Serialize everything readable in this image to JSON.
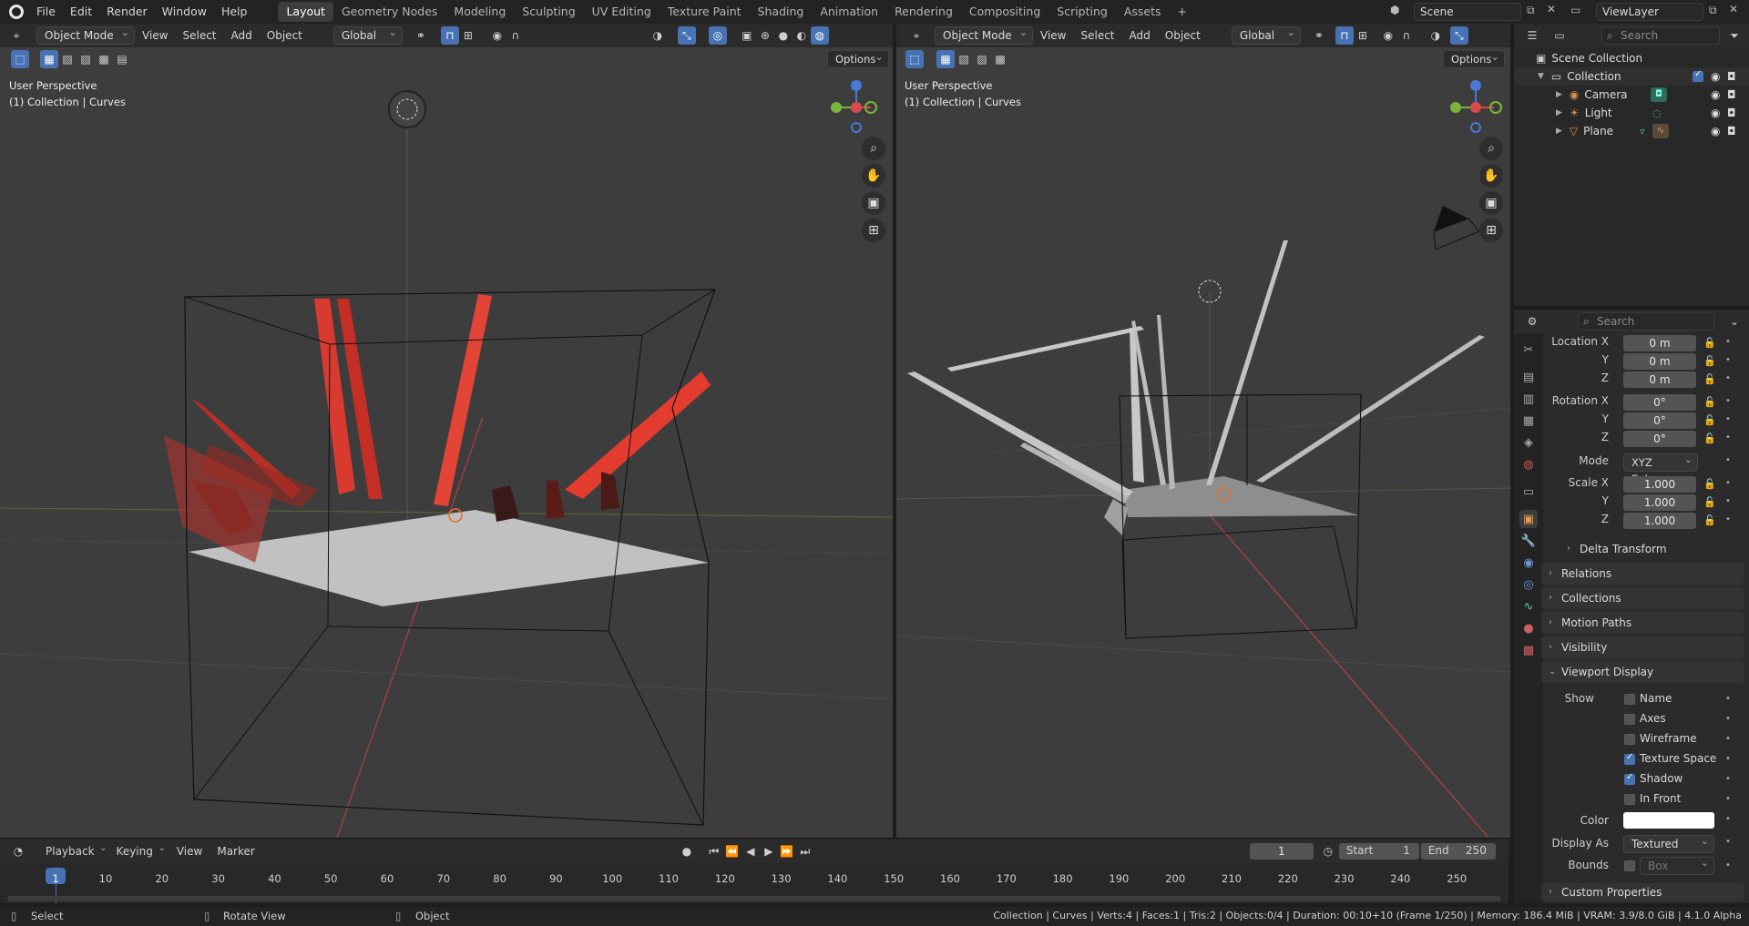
{
  "topbar": {
    "menus": [
      "File",
      "Edit",
      "Render",
      "Window",
      "Help"
    ],
    "workspaces": [
      "Layout",
      "Geometry Nodes",
      "Modeling",
      "Sculpting",
      "UV Editing",
      "Texture Paint",
      "Shading",
      "Animation",
      "Rendering",
      "Compositing",
      "Scripting",
      "Assets"
    ],
    "active_workspace": "Layout",
    "add_workspace": "+",
    "scene": "Scene",
    "view_layer": "ViewLayer"
  },
  "viewport_left": {
    "mode": "Object Mode",
    "menus": [
      "View",
      "Select",
      "Add",
      "Object"
    ],
    "orientation": "Global",
    "options": "Options",
    "perspective": "User Perspective",
    "collection_info": "(1) Collection | Curves"
  },
  "viewport_right": {
    "mode": "Object Mode",
    "menus": [
      "View",
      "Select",
      "Add",
      "Object"
    ],
    "orientation": "Global",
    "options": "Options",
    "perspective": "User Perspective",
    "collection_info": "(1) Collection | Curves"
  },
  "outliner": {
    "search_placeholder": "Search",
    "scene_collection": "Scene Collection",
    "collection": "Collection",
    "items": [
      {
        "name": "Camera",
        "icon": "camera-icon"
      },
      {
        "name": "Light",
        "icon": "light-icon"
      },
      {
        "name": "Plane",
        "icon": "mesh-icon"
      }
    ]
  },
  "properties": {
    "search_placeholder": "Search",
    "location": {
      "label": "Location X",
      "x": "0 m",
      "y": "0 m",
      "z": "0 m"
    },
    "rotation": {
      "label": "Rotation X",
      "x": "0°",
      "y": "0°",
      "z": "0°"
    },
    "axis_y": "Y",
    "axis_z": "Z",
    "mode_label": "Mode",
    "mode_value": "XYZ Euler",
    "scale": {
      "label": "Scale X",
      "x": "1.000",
      "y": "1.000",
      "z": "1.000"
    },
    "delta_transform": "Delta Transform",
    "panels": [
      "Relations",
      "Collections",
      "Motion Paths",
      "Visibility"
    ],
    "viewport_display": "Viewport Display",
    "show_label": "Show",
    "show_options": [
      {
        "label": "Name",
        "checked": false
      },
      {
        "label": "Axes",
        "checked": false
      },
      {
        "label": "Wireframe",
        "checked": false
      },
      {
        "label": "Texture Space",
        "checked": true
      },
      {
        "label": "Shadow",
        "checked": true
      },
      {
        "label": "In Front",
        "checked": false
      }
    ],
    "color_label": "Color",
    "color_value": "#ffffff",
    "display_as_label": "Display As",
    "display_as_value": "Textured",
    "bounds_label": "Bounds",
    "bounds_value": "Box",
    "custom_properties": "Custom Properties"
  },
  "timeline": {
    "menus": [
      "Playback",
      "Keying",
      "View",
      "Marker"
    ],
    "current_frame": "1",
    "start_label": "Start",
    "start": "1",
    "end_label": "End",
    "end": "250",
    "ticks": [
      "1",
      "10",
      "20",
      "30",
      "40",
      "50",
      "60",
      "70",
      "80",
      "90",
      "100",
      "110",
      "120",
      "130",
      "140",
      "150",
      "160",
      "170",
      "180",
      "190",
      "200",
      "210",
      "220",
      "230",
      "240",
      "250"
    ]
  },
  "statusbar": {
    "select": "Select",
    "rotate_view": "Rotate View",
    "object": "Object",
    "stats": "Collection | Curves | Verts:4 | Faces:1 | Tris:2 | Objects:0/4 | Duration: 00:10+10 (Frame 1/250) | Memory: 186.4 MiB | VRAM: 3.9/8.0 GiB | 4.1.0 Alpha"
  }
}
